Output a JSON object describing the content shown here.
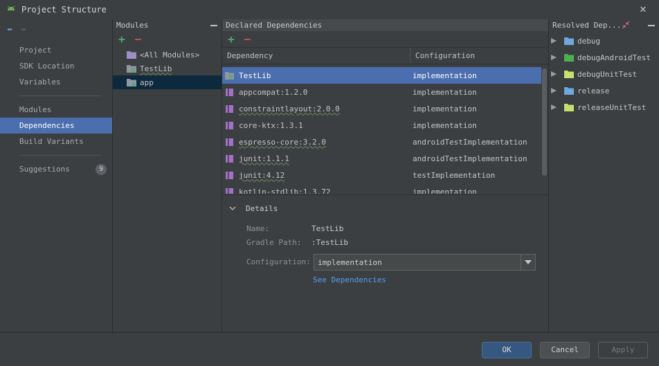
{
  "window": {
    "title": "Project Structure"
  },
  "sidebar": {
    "items": [
      {
        "label": "Project"
      },
      {
        "label": "SDK Location"
      },
      {
        "label": "Variables"
      },
      {
        "label": "Modules"
      },
      {
        "label": "Dependencies"
      },
      {
        "label": "Build Variants"
      },
      {
        "label": "Suggestions",
        "badge": "9"
      }
    ]
  },
  "modules": {
    "header": "Modules",
    "items": [
      {
        "label": "<All Modules>"
      },
      {
        "label": "TestLib"
      },
      {
        "label": "app"
      }
    ]
  },
  "declared": {
    "header": "Declared Dependencies",
    "columns": {
      "dependency": "Dependency",
      "configuration": "Configuration"
    },
    "rows": [
      {
        "name": "TestLib",
        "config": "implementation"
      },
      {
        "name": "appcompat:1.2.0",
        "config": "implementation"
      },
      {
        "name": "constraintlayout:2.0.0",
        "config": "implementation"
      },
      {
        "name": "core-ktx:1.3.1",
        "config": "implementation"
      },
      {
        "name": "espresso-core:3.2.0",
        "config": "androidTestImplementation"
      },
      {
        "name": "junit:1.1.1",
        "config": "androidTestImplementation"
      },
      {
        "name": "junit:4.12",
        "config": "testImplementation"
      },
      {
        "name": "kotlin-stdlib:1.3.72",
        "config": "implementation"
      }
    ]
  },
  "details": {
    "title": "Details",
    "name_label": "Name:",
    "name_value": "TestLib",
    "gradle_label": "Gradle Path:",
    "gradle_value": ":TestLib",
    "config_label": "Configuration:",
    "config_value": "implementation",
    "link": "See Dependencies"
  },
  "resolved": {
    "header": "Resolved Dep...",
    "items": [
      {
        "label": "debug",
        "color": "#6fa8dc"
      },
      {
        "label": "debugAndroidTest",
        "color": "#4caf50"
      },
      {
        "label": "debugUnitTest",
        "color": "#c5e06e"
      },
      {
        "label": "release",
        "color": "#6fa8dc"
      },
      {
        "label": "releaseUnitTest",
        "color": "#c5e06e"
      }
    ]
  },
  "buttons": {
    "ok": "OK",
    "cancel": "Cancel",
    "apply": "Apply"
  },
  "colors": {
    "accent": "#4b6eaf",
    "link": "#589df6",
    "add": "#58a66a",
    "remove": "#c75450"
  }
}
